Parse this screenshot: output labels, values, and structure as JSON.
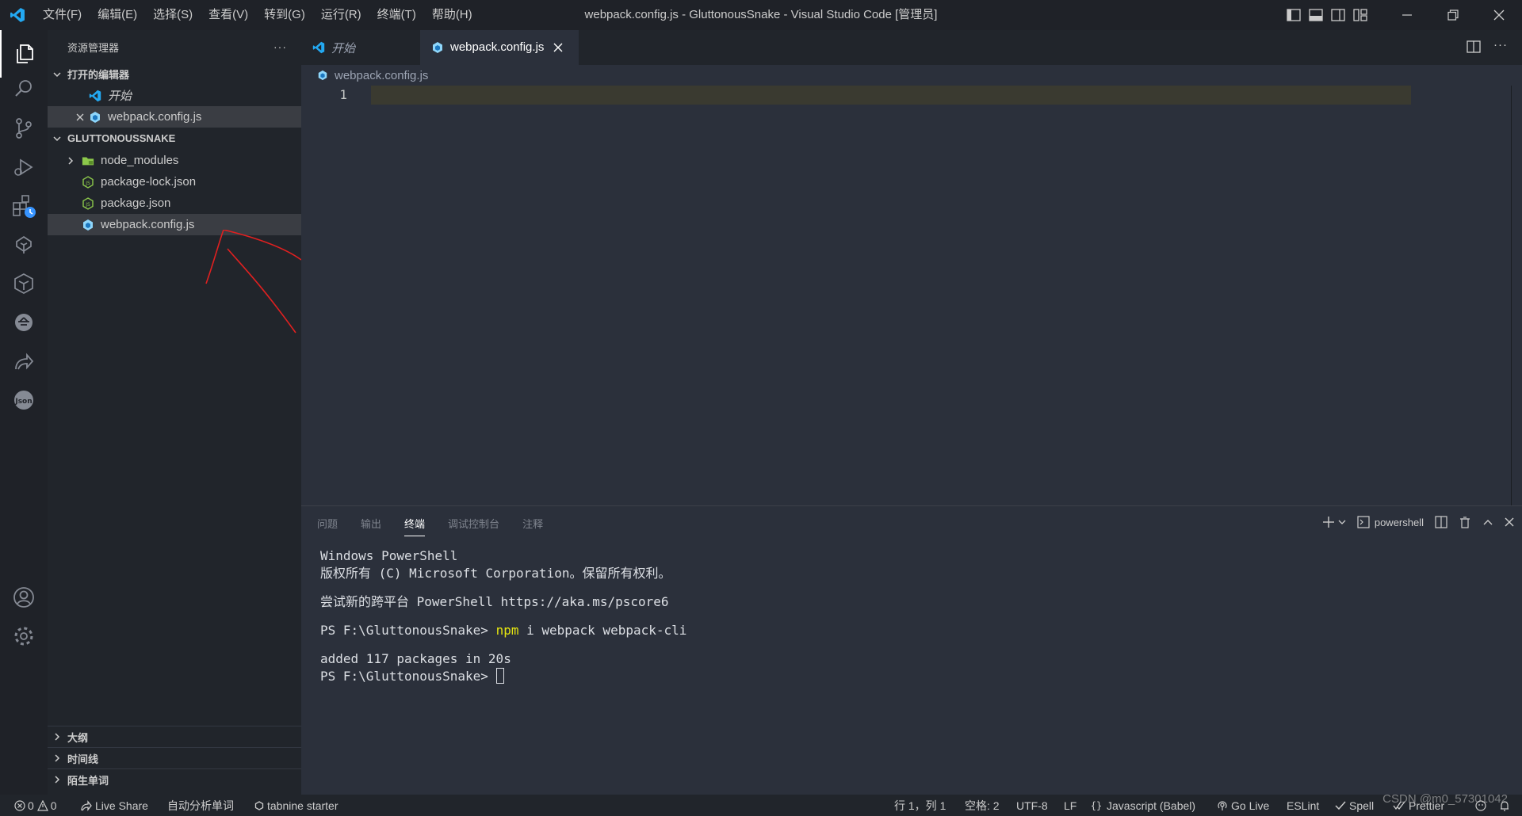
{
  "titlebar": {
    "menu": [
      "文件(F)",
      "编辑(E)",
      "选择(S)",
      "查看(V)",
      "转到(G)",
      "运行(R)",
      "终端(T)",
      "帮助(H)"
    ],
    "window_title": "webpack.config.js - GluttonousSnake - Visual Studio Code [管理员]"
  },
  "sidebar": {
    "title": "资源管理器",
    "more": "···",
    "open_editors_header": "打开的编辑器",
    "open_editors": [
      {
        "label": "开始",
        "icon": "vscode-icon"
      },
      {
        "label": "webpack.config.js",
        "icon": "webpack-icon"
      }
    ],
    "project_header": "GLUTTONOUSSNAKE",
    "files": [
      {
        "label": "node_modules",
        "icon": "folder-icon"
      },
      {
        "label": "package-lock.json",
        "icon": "nodejs-icon"
      },
      {
        "label": "package.json",
        "icon": "nodejs-icon"
      },
      {
        "label": "webpack.config.js",
        "icon": "webpack-icon"
      }
    ],
    "bottom_sections": [
      "大纲",
      "时间线",
      "陌生单词"
    ]
  },
  "editor": {
    "tabs": [
      {
        "label": "开始"
      },
      {
        "label": "webpack.config.js"
      }
    ],
    "breadcrumb": "webpack.config.js",
    "line_number": "1"
  },
  "panel": {
    "tabs": [
      "问题",
      "输出",
      "终端",
      "调试控制台",
      "注释"
    ],
    "active_tab": "终端",
    "shell": "powershell",
    "terminal": {
      "line1": "Windows PowerShell",
      "line2": "版权所有 (C) Microsoft Corporation。保留所有权利。",
      "line3": "尝试新的跨平台 PowerShell https://aka.ms/pscore6",
      "prompt": "PS F:\\GluttonousSnake> ",
      "command": "npm",
      "args": " i webpack webpack-cli",
      "line5": "added 117 packages in 20s",
      "prompt2": "PS F:\\GluttonousSnake> "
    }
  },
  "statusbar": {
    "errors": "0",
    "warnings": "0",
    "live_share": "Live Share",
    "auto_analyze": "自动分析单词",
    "tabnine": "tabnine starter",
    "position": "行 1，列 1",
    "spaces": "空格: 2",
    "encoding": "UTF-8",
    "eol": "LF",
    "language": "Javascript (Babel)",
    "go_live": "Go Live",
    "eslint": "ESLint",
    "spell": "Spell",
    "prettier": "Prettier"
  },
  "watermark": "CSDN @m0_57301042",
  "colors": {
    "background": "#1f2228",
    "sidebar": "#21252b",
    "editor": "#2b303b",
    "selected_row": "#3a3d43",
    "current_line": "#3a3a30",
    "webpack_blue": "#8ed6fb",
    "vscode_blue": "#23a9f2",
    "node_green": "#8cc84b",
    "annotation_red": "#e02020"
  }
}
